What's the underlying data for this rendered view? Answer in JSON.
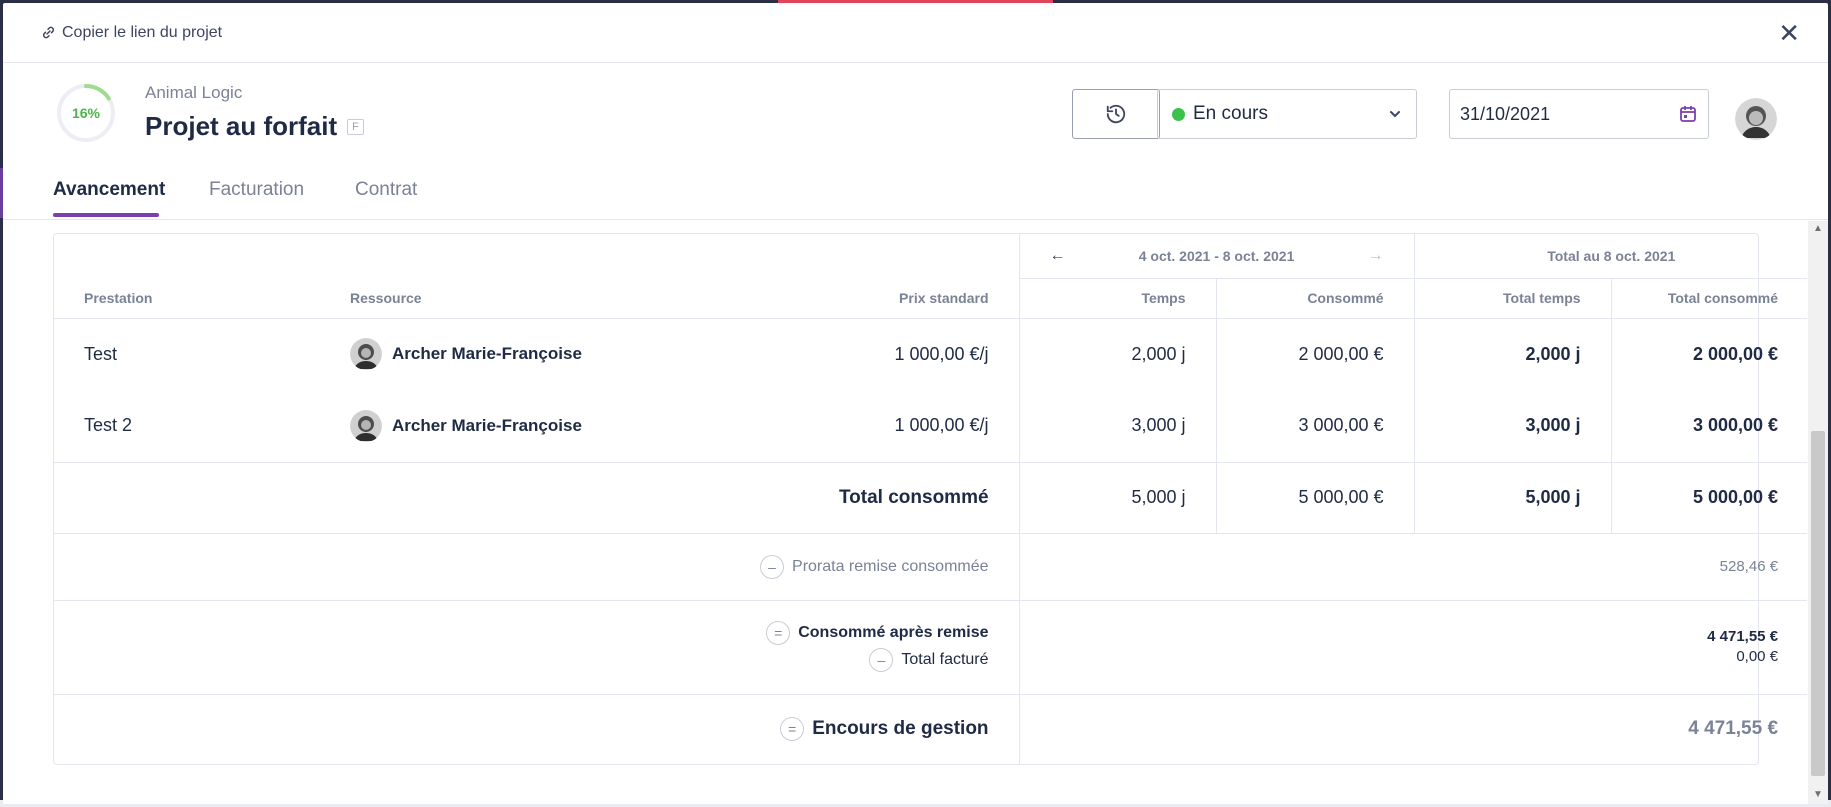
{
  "topbar": {
    "copy_link_label": "Copier le lien du projet"
  },
  "project": {
    "progress_value": 16,
    "progress_label": "16%",
    "client": "Animal Logic",
    "title": "Projet au forfait",
    "type_badge": "F",
    "status": "En cours",
    "status_color": "#3cc24a",
    "date": "31/10/2021"
  },
  "tabs": [
    {
      "label": "Avancement",
      "active": true
    },
    {
      "label": "Facturation",
      "active": false
    },
    {
      "label": "Contrat",
      "active": false
    }
  ],
  "table": {
    "period_label": "4 oct. 2021 - 8 oct. 2021",
    "total_header": "Total au 8 oct. 2021",
    "columns": {
      "prestation": "Prestation",
      "ressource": "Ressource",
      "prix": "Prix standard",
      "temps": "Temps",
      "consomme": "Consommé",
      "total_temps": "Total temps",
      "total_consomme": "Total consommé"
    },
    "rows": [
      {
        "prestation": "Test",
        "ressource": "Archer Marie-Françoise",
        "prix": "1 000,00 €/j",
        "temps": "2,000 j",
        "consomme": "2 000,00 €",
        "total_temps": "2,000 j",
        "total_consomme": "2 000,00 €"
      },
      {
        "prestation": "Test 2",
        "ressource": "Archer Marie-Françoise",
        "prix": "1 000,00 €/j",
        "temps": "3,000 j",
        "consomme": "3 000,00 €",
        "total_temps": "3,000 j",
        "total_consomme": "3 000,00 €"
      }
    ],
    "total": {
      "label": "Total consommé",
      "temps": "5,000 j",
      "consomme": "5 000,00 €",
      "total_temps": "5,000 j",
      "total_consomme": "5 000,00 €"
    },
    "summary": {
      "prorata_op": "–",
      "prorata_label": "Prorata remise consommée",
      "prorata_value": "528,46 €",
      "apres_op": "=",
      "apres_label": "Consommé après remise",
      "apres_value": "4 471,55 €",
      "facture_op": "–",
      "facture_label": "Total facturé",
      "facture_value": "0,00 €",
      "encours_op": "=",
      "encours_label": "Encours de gestion",
      "encours_value": "4 471,55 €"
    }
  },
  "icons": {
    "link": "link-icon",
    "close": "close-icon",
    "history": "history-icon",
    "chevron": "chevron-down-icon",
    "calendar": "calendar-icon",
    "prev": "arrow-left-icon",
    "next": "arrow-right-icon"
  }
}
